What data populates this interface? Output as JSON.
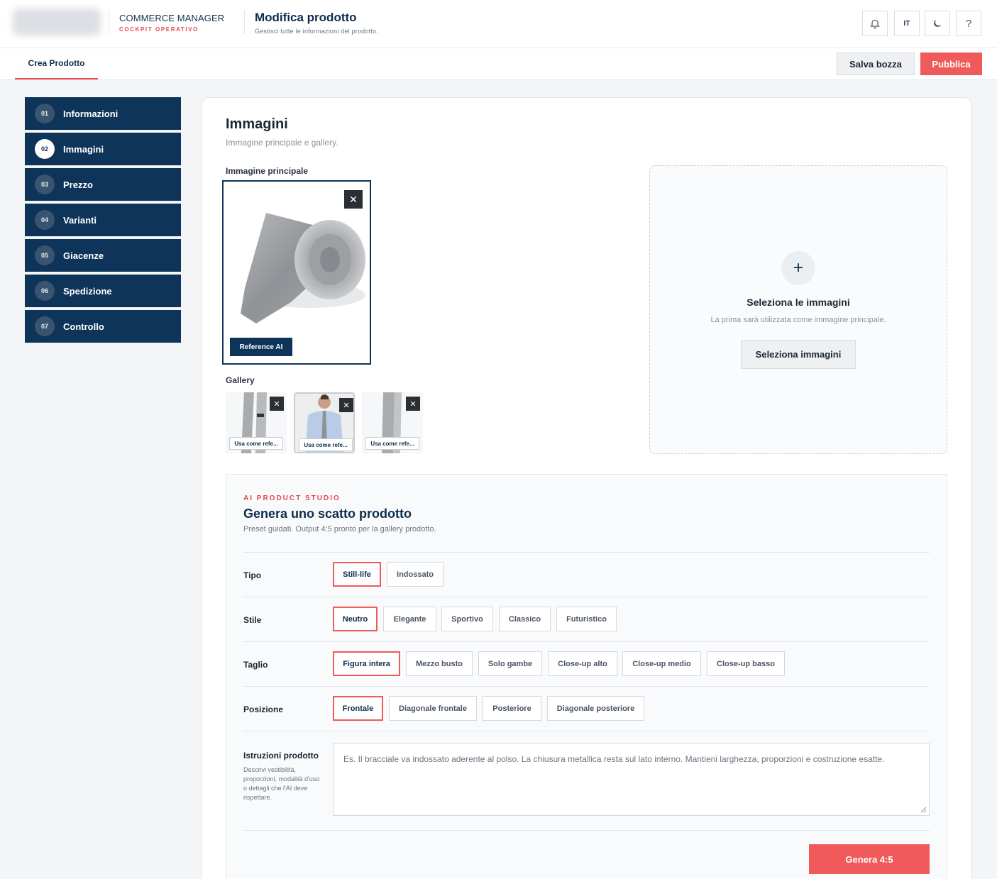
{
  "header": {
    "brand_title": "COMMERCE MANAGER",
    "brand_subtitle": "COCKPIT OPERATIVO",
    "page_title": "Modifica prodotto",
    "page_subtitle": "Gestisci tutte le informazioni del prodotto.",
    "language": "IT",
    "help": "?"
  },
  "tabs": {
    "active": "Crea Prodotto",
    "save_draft": "Salva bozza",
    "publish": "Pubblica"
  },
  "steps": [
    {
      "num": "01",
      "label": "Informazioni"
    },
    {
      "num": "02",
      "label": "Immagini"
    },
    {
      "num": "03",
      "label": "Prezzo"
    },
    {
      "num": "04",
      "label": "Varianti"
    },
    {
      "num": "05",
      "label": "Giacenze"
    },
    {
      "num": "06",
      "label": "Spedizione"
    },
    {
      "num": "07",
      "label": "Controllo"
    }
  ],
  "images": {
    "title": "Immagini",
    "subtitle": "Immagine principale e gallery.",
    "main_label": "Immagine principale",
    "reference_badge": "Reference AI",
    "gallery_label": "Gallery",
    "gallery": [
      {
        "use_label": "Usa come refe..."
      },
      {
        "use_label": "Usa come refe..."
      },
      {
        "use_label": "Usa come refe..."
      }
    ],
    "close": "✕",
    "dropzone": {
      "plus": "+",
      "title": "Seleziona le immagini",
      "subtitle": "La prima sarà utilizzata come immagine principale.",
      "button": "Seleziona immagini"
    }
  },
  "studio": {
    "tag": "AI PRODUCT STUDIO",
    "title": "Genera uno scatto prodotto",
    "subtitle": "Preset guidati. Output 4:5 pronto per la gallery prodotto.",
    "rows": {
      "tipo": {
        "label": "Tipo",
        "options": [
          "Still-life",
          "Indossato"
        ],
        "selected": "Still-life"
      },
      "stile": {
        "label": "Stile",
        "options": [
          "Neutro",
          "Elegante",
          "Sportivo",
          "Classico",
          "Futuristico"
        ],
        "selected": "Neutro"
      },
      "taglio": {
        "label": "Taglio",
        "options": [
          "Figura intera",
          "Mezzo busto",
          "Solo gambe",
          "Close-up alto",
          "Close-up medio",
          "Close-up basso"
        ],
        "selected": "Figura intera"
      },
      "posizione": {
        "label": "Posizione",
        "options": [
          "Frontale",
          "Diagonale frontale",
          "Posteriore",
          "Diagonale posteriore"
        ],
        "selected": "Frontale"
      }
    },
    "instructions_label": "Istruzioni prodotto",
    "instructions_help": "Descrivi vestibilità, proporzioni, modalità d'uso o dettagli che l'AI deve rispettare.",
    "instructions_placeholder": "Es. Il bracciale va indossato aderente al polso. La chiusura metallica resta sul lato interno. Mantieni larghezza, proporzioni e costruzione esatte.",
    "generate": "Genera 4:5"
  },
  "colors": {
    "navy": "#0f3459",
    "accent": "#f05a5a",
    "background": "#f3f5f7"
  }
}
